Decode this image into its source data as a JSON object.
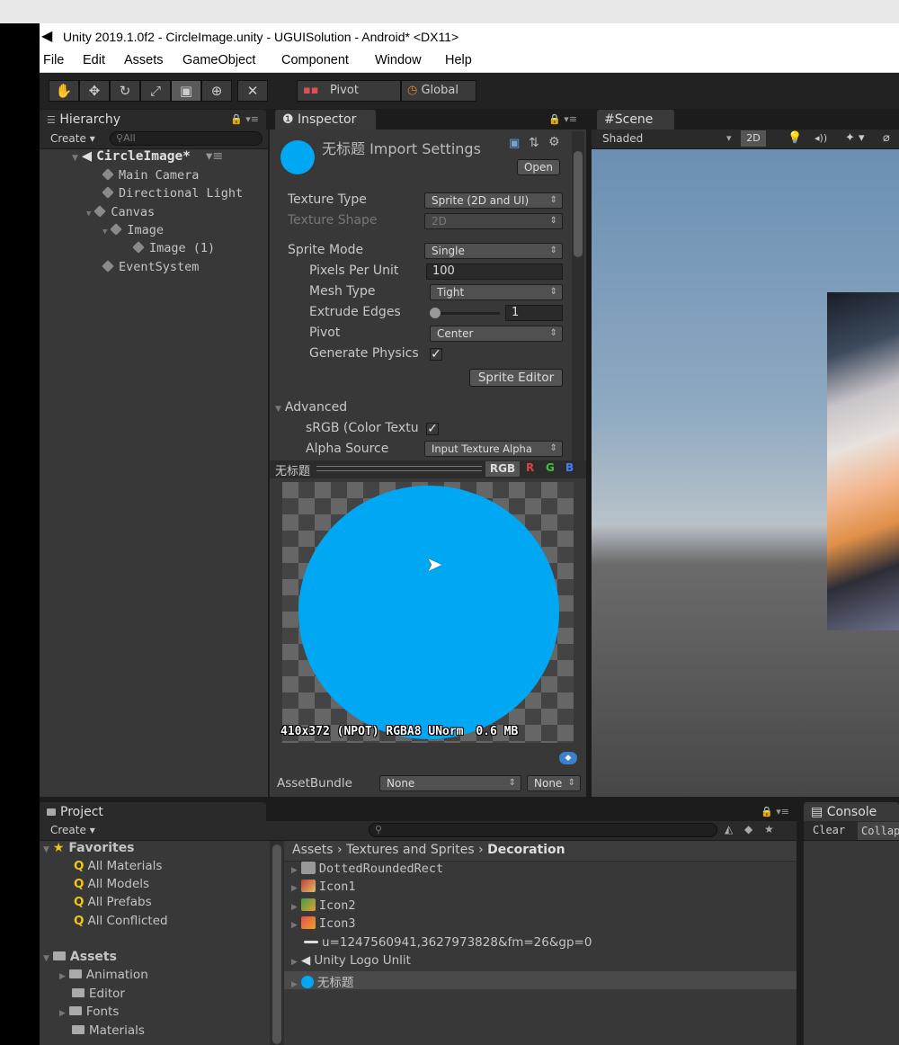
{
  "window": {
    "title": "Unity 2019.1.0f2 - CircleImage.unity - UGUISolution - Android* <DX11>"
  },
  "menu": [
    "File",
    "Edit",
    "Assets",
    "GameObject",
    "Component",
    "Window",
    "Help"
  ],
  "toolbar": {
    "pivot_label": "Pivot",
    "global_label": "Global"
  },
  "hierarchy": {
    "tab": "Hierarchy",
    "create_label": "Create",
    "search_placeholder": "All",
    "scene_name": "CircleImage*",
    "items": [
      "Main Camera",
      "Directional Light",
      "Canvas",
      "Image",
      "Image (1)",
      "EventSystem"
    ]
  },
  "inspector": {
    "tab": "Inspector",
    "asset_title": "无标题 Import Settings",
    "open_label": "Open",
    "rows": {
      "texture_type_label": "Texture Type",
      "texture_type_value": "Sprite (2D and UI)",
      "texture_shape_label": "Texture Shape",
      "texture_shape_value": "2D",
      "sprite_mode_label": "Sprite Mode",
      "sprite_mode_value": "Single",
      "ppu_label": "Pixels Per Unit",
      "ppu_value": "100",
      "mesh_type_label": "Mesh Type",
      "mesh_type_value": "Tight",
      "extrude_label": "Extrude Edges",
      "extrude_value": "1",
      "pivot_label": "Pivot",
      "pivot_value": "Center",
      "gen_physics_label": "Generate Physics",
      "advanced_label": "Advanced",
      "srgb_label": "sRGB (Color Textu",
      "alpha_source_label": "Alpha Source",
      "alpha_source_value": "Input Texture Alpha"
    },
    "sprite_editor_label": "Sprite Editor",
    "preview": {
      "name": "无标题",
      "channels": [
        "RGB",
        "R",
        "G",
        "B"
      ],
      "circle_color": "#00a8f3",
      "info_size": "410x372 (NPOT)",
      "info_format": "RGBA8 UNorm",
      "info_mem": "0.6 MB"
    },
    "assetbundle_label": "AssetBundle",
    "assetbundle_value": "None",
    "assetbundle_variant": "None"
  },
  "scene": {
    "tab": "Scene",
    "shading": "Shaded",
    "mode_2d": "2D"
  },
  "project": {
    "tab": "Project",
    "create_label": "Create",
    "favorites_label": "Favorites",
    "favorites": [
      "All Materials",
      "All Models",
      "All Prefabs",
      "All Conflicted"
    ],
    "assets_label": "Assets",
    "folders": [
      "Animation",
      "Editor",
      "Fonts",
      "Materials"
    ],
    "breadcrumb": [
      "Assets",
      "Textures and Sprites",
      "Decoration"
    ],
    "files": [
      "DottedRoundedRect",
      "Icon1",
      "Icon2",
      "Icon3",
      "u=1247560941,3627973828&fm=26&gp=0",
      "Unity Logo Unlit",
      "无标题"
    ]
  },
  "console": {
    "tab": "Console",
    "clear_label": "Clear",
    "collapse_label": "Collap"
  }
}
